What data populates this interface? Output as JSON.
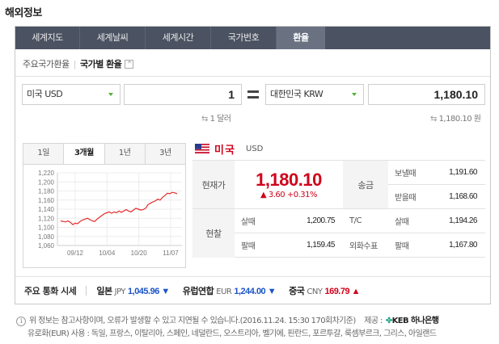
{
  "page_title": "해외정보",
  "tabs": [
    {
      "label": "세계지도"
    },
    {
      "label": "세계날씨"
    },
    {
      "label": "세계시간"
    },
    {
      "label": "국가번호"
    },
    {
      "label": "환율"
    }
  ],
  "subnav": {
    "item1": "주요국가환율",
    "item2": "국가별 환율",
    "toggle": "^"
  },
  "converter": {
    "from_currency": "미국 USD",
    "from_amount": "1",
    "from_unit": "1 달러",
    "to_currency": "대한민국 KRW",
    "to_amount": "1,180.10",
    "to_unit": "1,180.10 원"
  },
  "periods": [
    "1일",
    "3개월",
    "1년",
    "3년"
  ],
  "chart_data": {
    "type": "line",
    "x_ticks": [
      "09/12",
      "10/04",
      "10/20",
      "11/07"
    ],
    "y_ticks": [
      "1,220",
      "1,200",
      "1,180",
      "1,160",
      "1,140",
      "1,120",
      "1,100",
      "1,080",
      "1,060"
    ],
    "ylim": [
      1060,
      1220
    ],
    "values": [
      1114,
      1113,
      1112,
      1114,
      1111,
      1106,
      1109,
      1108,
      1113,
      1116,
      1118,
      1120,
      1117,
      1114,
      1113,
      1118,
      1122,
      1126,
      1130,
      1132,
      1134,
      1131,
      1134,
      1132,
      1136,
      1133,
      1136,
      1139,
      1136,
      1134,
      1138,
      1142,
      1140,
      1138,
      1139,
      1142,
      1150,
      1153,
      1156,
      1158,
      1162,
      1160,
      1166,
      1170,
      1175,
      1174,
      1177,
      1176,
      1174
    ],
    "line_color": "#e52a2a",
    "grid": true
  },
  "country": {
    "name": "미국",
    "code": "USD",
    "flag": "us-flag"
  },
  "rates": {
    "current_label": "현재가",
    "current_rate": "1,180.10",
    "change": "▲ 3.60 +0.31%",
    "remit_label": "송금",
    "send_label": "보낼때",
    "send_val": "1,191.60",
    "recv_label": "받을때",
    "recv_val": "1,168.60",
    "cash_label": "현찰",
    "buy_label": "살때",
    "cash_buy": "1,200.75",
    "sell_label": "팔때",
    "cash_sell": "1,159.45",
    "tc_label": "T/C",
    "tc_buy_label": "살때",
    "tc_buy": "1,194.26",
    "check_label": "외화수표",
    "check_sell_label": "팔때",
    "check_sell": "1,167.80"
  },
  "major": {
    "title": "주요 통화 시세",
    "items": [
      {
        "name": "일본",
        "code": "JPY",
        "value": "1,045.96 ▼",
        "dir": "down"
      },
      {
        "name": "유럽연합",
        "code": "EUR",
        "value": "1,244.00 ▼",
        "dir": "down"
      },
      {
        "name": "중국",
        "code": "CNY",
        "value": "169.79 ▲",
        "dir": "up"
      }
    ]
  },
  "footer": {
    "line1": "위 정보는 참고사항이며, 오류가 발생할 수 있고 지연될 수 있습니다.(2016.11.24. 15:30 170회차기준)",
    "provider_label": "제공 :",
    "provider_name": "KEB 하나은행",
    "line2": "유로화(EUR) 사용 : 독일, 프랑스, 이탈리아, 스페인, 네덜란드, 오스트리아, 벨기에, 핀란드, 포르투갈, 룩셈부르크, 그리스, 아일랜드"
  }
}
